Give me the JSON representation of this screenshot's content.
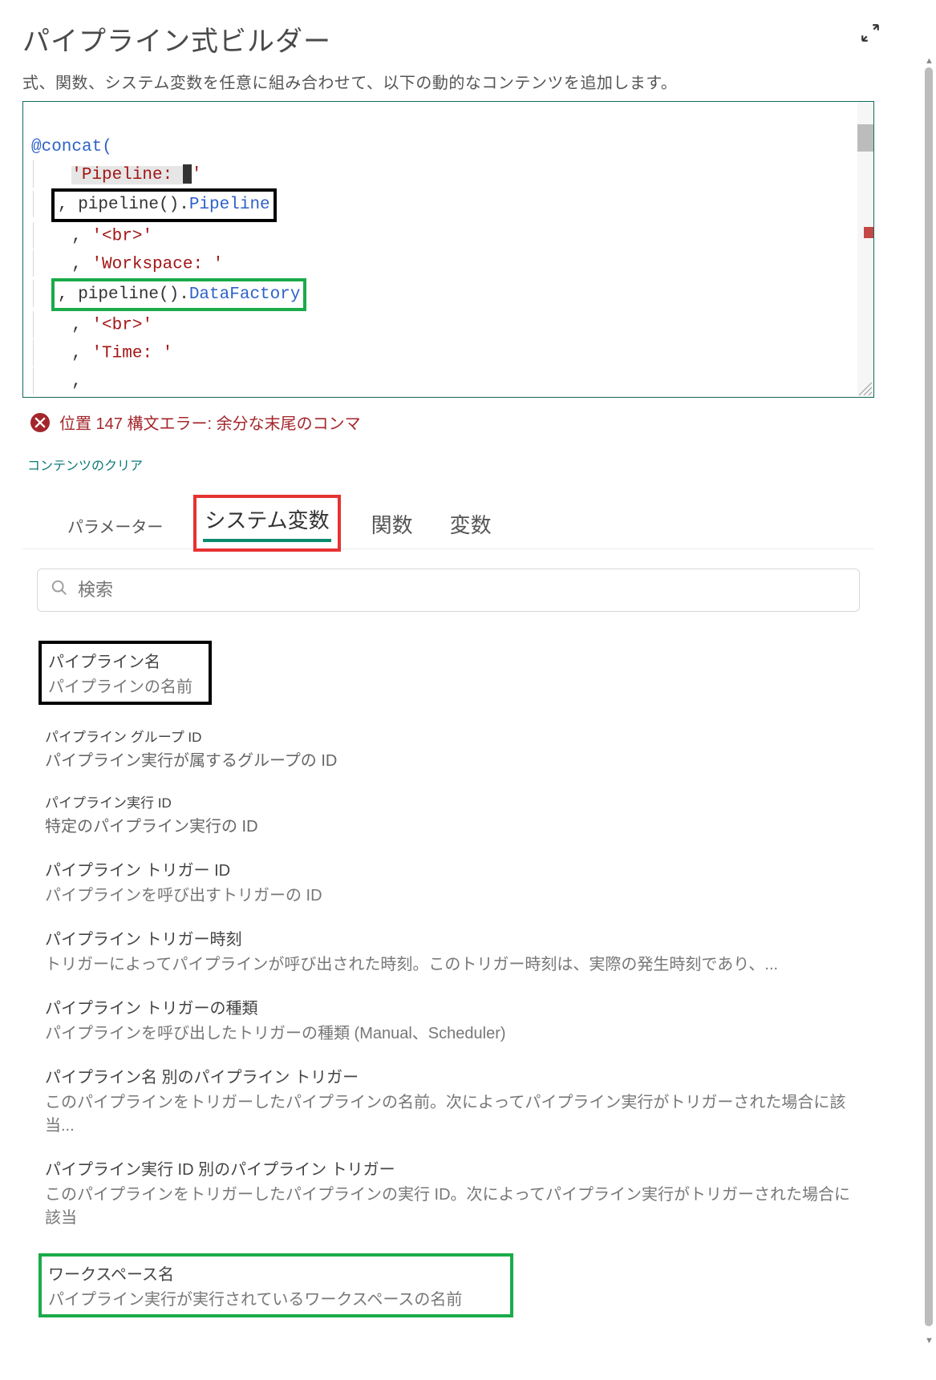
{
  "title": "パイプライン式ビルダー",
  "subtitle": "式、関数、システム変数を任意に組み合わせて、以下の動的なコンテンツを追加します。",
  "editor": {
    "tokens": {
      "concat": "@concat(",
      "str_pipeline": "'Pipeline: ",
      "pipeline_call": ", pipeline().",
      "prop_pipeline": "Pipeline",
      "str_br": "'<br>'",
      "str_workspace": "'Workspace: '",
      "prop_datafactory": "DataFactory",
      "str_time": "'Time: '",
      "comma": ", ",
      "close": ")",
      "quote": "'"
    }
  },
  "error": "位置 147 構文エラー: 余分な末尾のコンマ",
  "clear": "コンテンツのクリア",
  "tabs": {
    "parameters": "パラメーター",
    "system_vars": "システム変数",
    "functions": "関数",
    "variables": "変数"
  },
  "search": {
    "placeholder": "検索"
  },
  "items": [
    {
      "title": "パイプライン名",
      "desc": "パイプラインの名前"
    },
    {
      "title": "パイプライン グループ ID",
      "desc": "パイプライン実行が属するグループの ID"
    },
    {
      "title": "パイプライン実行 ID",
      "desc": "特定のパイプライン実行の ID"
    },
    {
      "title": "パイプライン トリガー ID",
      "desc": "パイプラインを呼び出すトリガーの ID"
    },
    {
      "title": "パイプライン トリガー時刻",
      "desc": "トリガーによってパイプラインが呼び出された時刻。このトリガー時刻は、実際の発生時刻であり、..."
    },
    {
      "title": "パイプライン トリガーの種類",
      "desc": "パイプラインを呼び出したトリガーの種類 (Manual、Scheduler)"
    },
    {
      "title": "パイプライン名 別のパイプライン トリガー",
      "desc": "このパイプラインをトリガーしたパイプラインの名前。次によってパイプライン実行がトリガーされた場合に該当..."
    },
    {
      "title": "パイプライン実行 ID 別のパイプライン トリガー",
      "desc": "このパイプラインをトリガーしたパイプラインの実行 ID。次によってパイプライン実行がトリガーされた場合に該当"
    },
    {
      "title": "ワークスペース名",
      "desc": "パイプライン実行が実行されているワークスペースの名前"
    }
  ]
}
